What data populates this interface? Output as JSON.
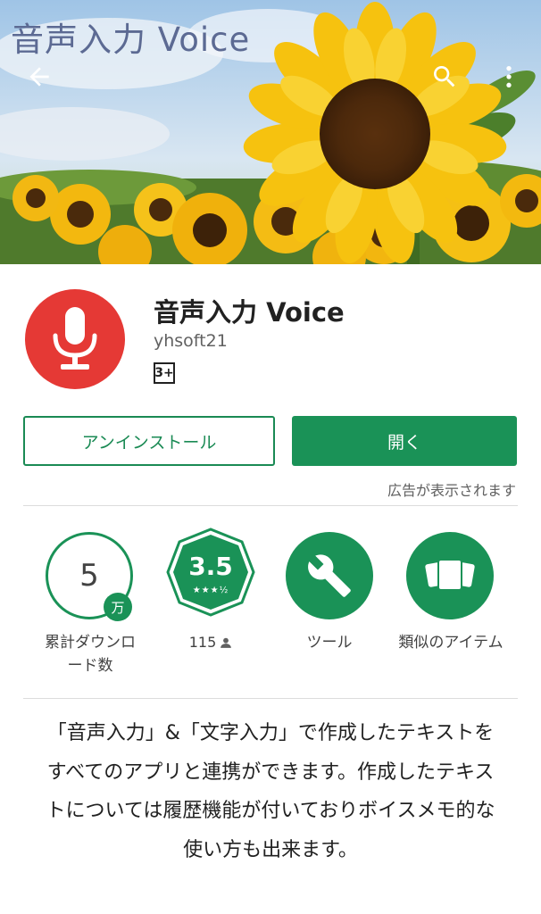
{
  "banner": {
    "overlay_title": "音声入力 Voice"
  },
  "toolbar": {
    "back_icon": "arrow-back-icon",
    "search_icon": "search-icon",
    "more_icon": "more-vert-icon"
  },
  "app": {
    "title": "音声入力 Voice",
    "developer": "yhsoft21",
    "content_rating": "3+",
    "icon": "microphone-icon",
    "icon_color": "#e53935"
  },
  "actions": {
    "uninstall_label": "アンインストール",
    "open_label": "開く",
    "ads_note": "広告が表示されます"
  },
  "stats": {
    "downloads_value": "5",
    "downloads_unit": "万",
    "downloads_label": "累計ダウンロード数",
    "rating_value": "3.5",
    "rating_stars": "★★★½",
    "reviews_count": "115",
    "category_label": "ツール",
    "similar_label": "類似のアイテム"
  },
  "description": "「音声入力」&「文字入力」で作成したテキストをすべてのアプリと連携ができます。作成したテキストについては履歴機能が付いておりボイスメモ的な使い方も出来ます。",
  "colors": {
    "accent": "#1a9257",
    "icon_red": "#e53935"
  }
}
